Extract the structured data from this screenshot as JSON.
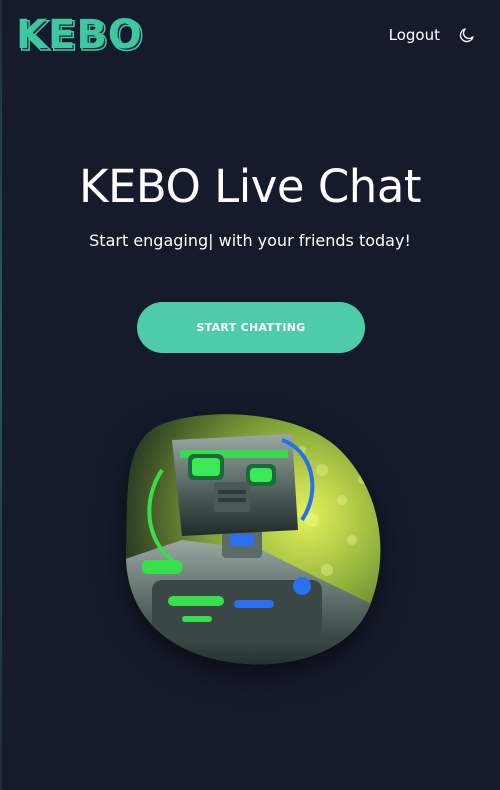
{
  "header": {
    "logo_text": "KEBO",
    "logout_label": "Logout",
    "theme_toggle_icon": "moon-icon"
  },
  "hero": {
    "title": "KEBO Live Chat",
    "subtitle": "Start engaging| with your friends today!",
    "cta_label": "START CHATTING",
    "image_icon": "robot-illustration"
  },
  "colors": {
    "background": "#151b2b",
    "accent": "#4ecba9",
    "logo_fill": "#3fc7a3",
    "text": "#ffffff"
  }
}
